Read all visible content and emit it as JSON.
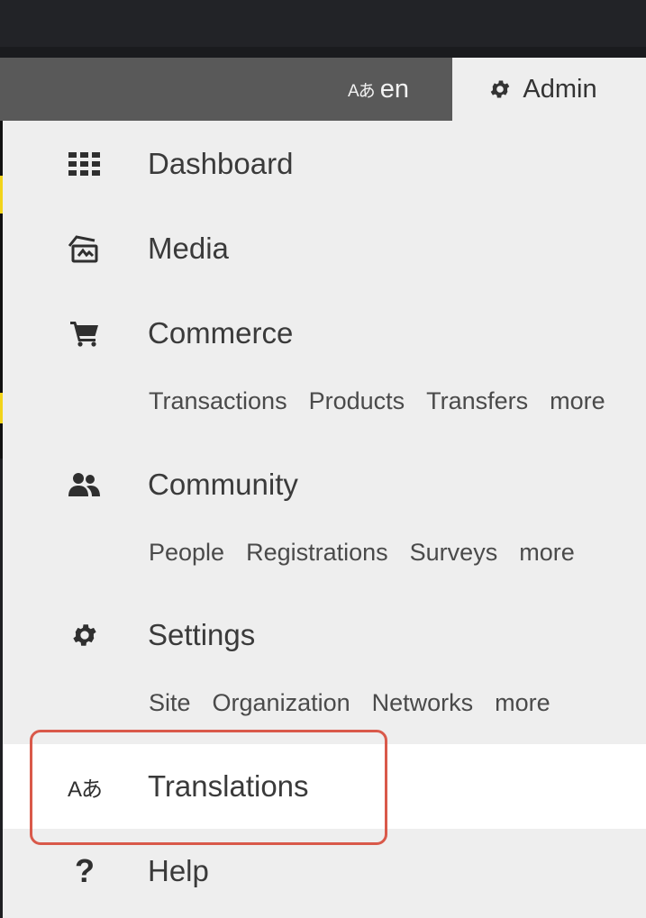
{
  "header": {
    "language_icon": "translate-icon",
    "language_icon_glyph": "Aあ",
    "language_label": "en",
    "admin_icon": "gear-icon",
    "admin_label": "Admin"
  },
  "menu": {
    "items": [
      {
        "id": "dashboard",
        "icon": "grid-icon",
        "label": "Dashboard",
        "sublinks": []
      },
      {
        "id": "media",
        "icon": "media-icon",
        "label": "Media",
        "sublinks": []
      },
      {
        "id": "commerce",
        "icon": "cart-icon",
        "label": "Commerce",
        "sublinks": [
          "Transactions",
          "Products",
          "Transfers",
          "more"
        ]
      },
      {
        "id": "community",
        "icon": "users-icon",
        "label": "Community",
        "sublinks": [
          "People",
          "Registrations",
          "Surveys",
          "more"
        ]
      },
      {
        "id": "settings",
        "icon": "gear-icon",
        "label": "Settings",
        "sublinks": [
          "Site",
          "Organization",
          "Networks",
          "more"
        ]
      },
      {
        "id": "translations",
        "icon": "translate-icon",
        "icon_glyph": "Aあ",
        "label": "Translations",
        "sublinks": [],
        "highlighted": true
      },
      {
        "id": "help",
        "icon": "question-icon",
        "icon_glyph": "?",
        "label": "Help",
        "sublinks": []
      }
    ]
  },
  "colors": {
    "topbar": "#222327",
    "navbar": "#595959",
    "dropdown": "#eeeeee",
    "highlight": "#ffffff",
    "callout_border": "#d9594a",
    "background_accent": "#f2d41b"
  }
}
